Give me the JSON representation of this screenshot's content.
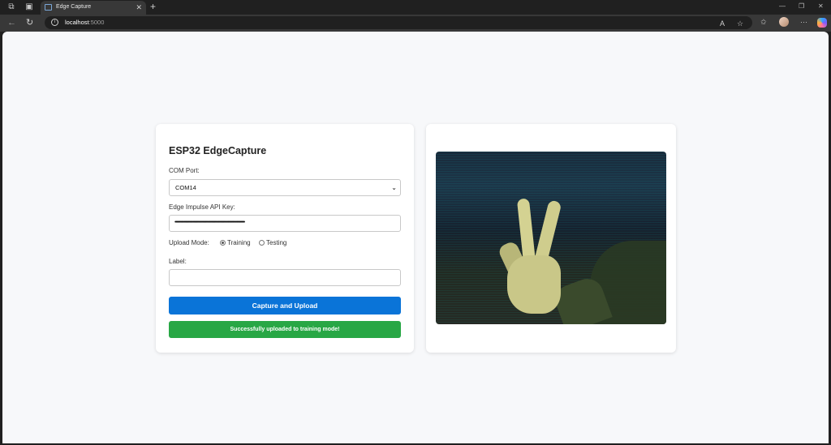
{
  "browser": {
    "tab_title": "Edge Capture",
    "url_host": "localhost",
    "url_port": ":5000"
  },
  "form": {
    "heading": "ESP32 EdgeCapture",
    "com_port_label": "COM Port:",
    "com_port_value": "COM14",
    "api_key_label": "Edge Impulse API Key:",
    "api_key_masked": "••••••••••••••••••••••••••••••••••••••••••••••••••••••••••••••••••••••••••••••",
    "upload_mode_label": "Upload Mode:",
    "upload_mode_options": [
      "Training",
      "Testing"
    ],
    "upload_mode_selected": "Training",
    "label_label": "Label:",
    "label_value": "",
    "capture_button": "Capture and Upload",
    "status_message": "Successfully uploaded to training mode!"
  },
  "colors": {
    "primary_button": "#0a74d8",
    "success": "#28a745",
    "page_bg": "#f7f8fa"
  },
  "icons": [
    "workspaces-icon",
    "tab-actions-icon",
    "close-icon",
    "plus-icon",
    "back-icon",
    "refresh-icon",
    "info-icon",
    "read-aloud-icon",
    "favorite-icon",
    "favorites-icon",
    "more-icon"
  ]
}
